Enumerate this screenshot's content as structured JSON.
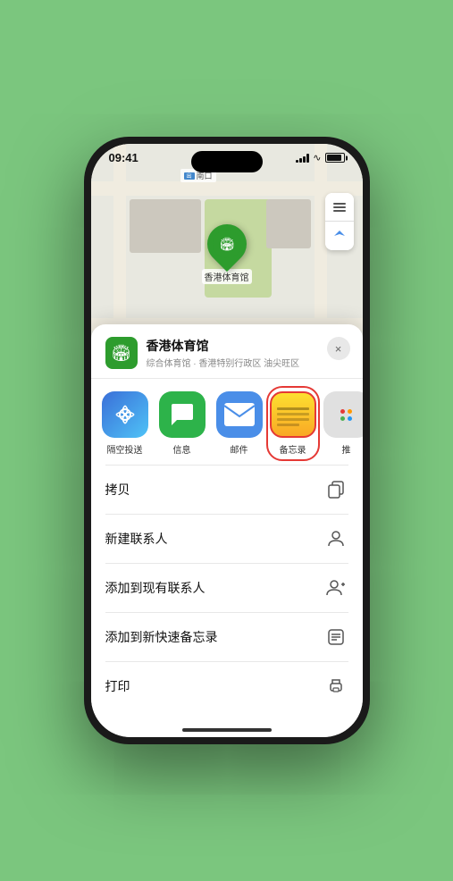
{
  "status_bar": {
    "time": "09:41",
    "location_arrow": "▶"
  },
  "map": {
    "south_entrance_label": "南口",
    "venue_name_pin": "香港体育馆"
  },
  "bottom_sheet": {
    "venue_name": "香港体育馆",
    "venue_sub": "综合体育馆 · 香港特别行政区 油尖旺区",
    "close_label": "×"
  },
  "share_apps": [
    {
      "id": "airdrop",
      "label": "隔空投送",
      "type": "airdrop"
    },
    {
      "id": "messages",
      "label": "信息",
      "type": "messages"
    },
    {
      "id": "mail",
      "label": "邮件",
      "type": "mail"
    },
    {
      "id": "notes",
      "label": "备忘录",
      "type": "notes"
    },
    {
      "id": "more",
      "label": "推",
      "type": "more"
    }
  ],
  "actions": [
    {
      "label": "拷贝",
      "icon": "copy"
    },
    {
      "label": "新建联系人",
      "icon": "person"
    },
    {
      "label": "添加到现有联系人",
      "icon": "person-add"
    },
    {
      "label": "添加到新快速备忘录",
      "icon": "memo"
    },
    {
      "label": "打印",
      "icon": "print"
    }
  ],
  "colors": {
    "green_brand": "#2d9c2d",
    "highlight_red": "#e53935",
    "notes_yellow": "#fde030"
  }
}
